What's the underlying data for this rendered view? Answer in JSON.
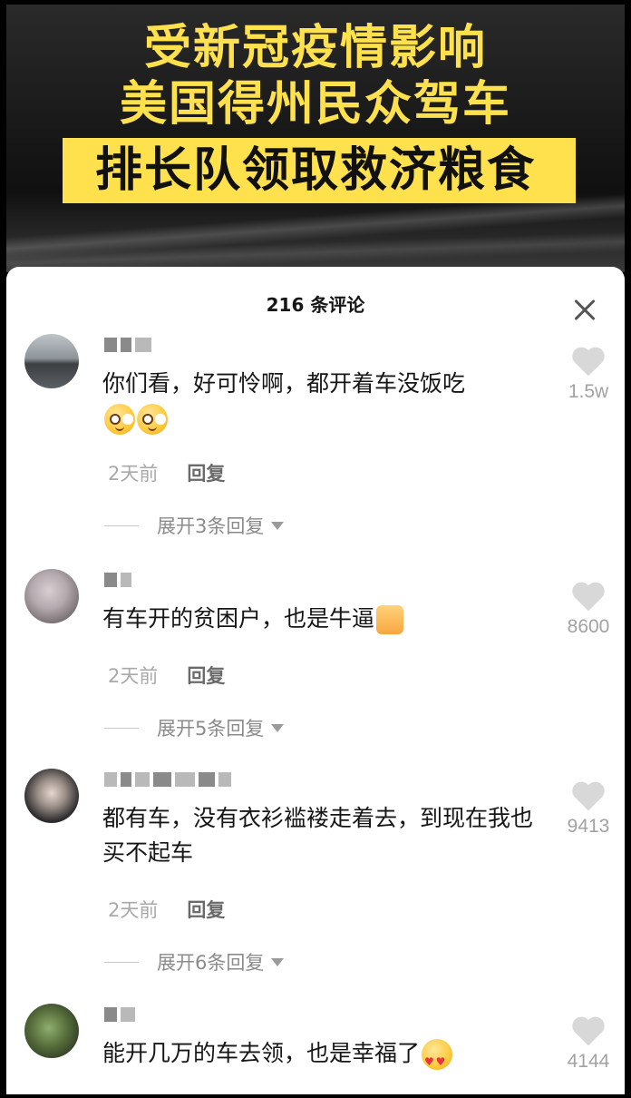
{
  "video": {
    "headline_line1": "受新冠疫情影响",
    "headline_line2": "美国得州民众驾车",
    "headline_line3": "排长队领取救济粮食"
  },
  "panel": {
    "title": "216 条评论",
    "close_icon": "close-icon"
  },
  "comments": [
    {
      "text": "你们看，好可怜啊，都开着车没饭吃",
      "emoji": [
        "pleading-face",
        "pleading-face"
      ],
      "time": "2天前",
      "reply_label": "回复",
      "expand_label": "展开3条回复",
      "likes": "1.5w"
    },
    {
      "text": "有车开的贫困户，也是牛逼",
      "emoji": [
        "thumbs-up"
      ],
      "time": "2天前",
      "reply_label": "回复",
      "expand_label": "展开5条回复",
      "likes": "8600"
    },
    {
      "text": "都有车，没有衣衫褴褛走着去，到现在我也买不起车",
      "emoji": [],
      "time": "2天前",
      "reply_label": "回复",
      "expand_label": "展开6条回复",
      "likes": "9413"
    },
    {
      "text": "能开几万的车去领，也是幸福了",
      "emoji": [
        "heart-eyes-face"
      ],
      "likes": "4144"
    }
  ],
  "colors": {
    "headline_yellow": "#ffe14d",
    "panel_bg": "#ffffff",
    "muted_text": "#a9a9a9",
    "heart_gray": "#d8d8d8"
  }
}
